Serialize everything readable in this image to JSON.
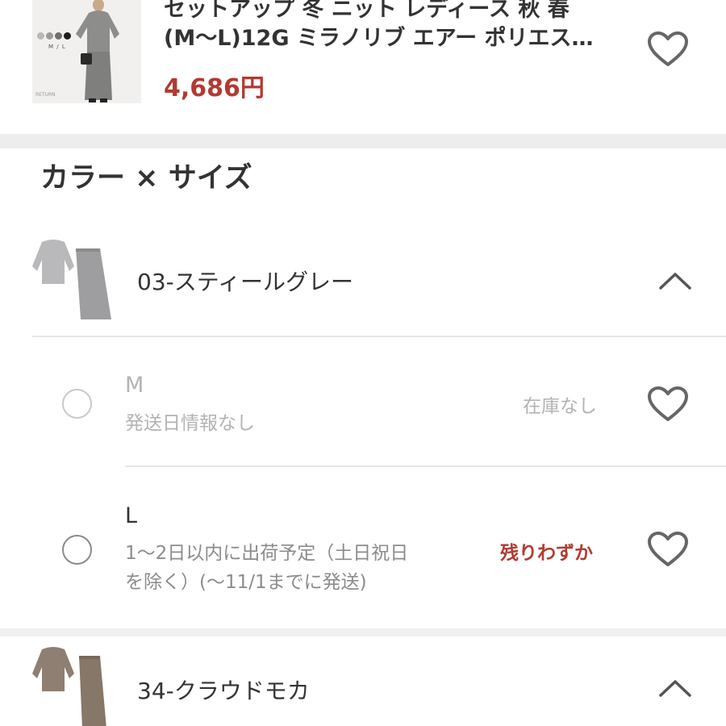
{
  "product": {
    "title_line1": "セットアップ 冬 ニット レディース 秋 春",
    "title_line2": "(M～L)12G ミラノリブ エアー ポリエス…",
    "price": "4,686円",
    "thumbnail": {
      "size_tag": "M / L",
      "brand": "RETURN",
      "swatches": [
        "#b8b8b8",
        "#9a9a9a",
        "#6f6f6f",
        "#1e1e1e"
      ]
    },
    "favorite_icon": "heart-outline-icon"
  },
  "section": {
    "title": "カラー × サイズ"
  },
  "colors": [
    {
      "label": "03-スティールグレー",
      "expanded": true,
      "icon": "chevron-up-icon",
      "sizes": [
        {
          "name": "M",
          "note": "発送日情報なし",
          "stock": "在庫なし",
          "available": false,
          "favorite_icon": "heart-outline-icon"
        },
        {
          "name": "L",
          "note_line1": "1～2日以内に出荷予定（土日祝日",
          "note_line2": "を除く）(～11/1までに発送)",
          "stock": "残りわずか",
          "available": true,
          "favorite_icon": "heart-outline-icon"
        }
      ]
    },
    {
      "label": "34-クラウドモカ",
      "expanded": true,
      "icon": "chevron-up-icon"
    }
  ],
  "theme": {
    "accent_red": "#b23a32",
    "text_dark": "#333333",
    "text_muted": "#b3b3b3",
    "icon_gray": "#666666"
  }
}
